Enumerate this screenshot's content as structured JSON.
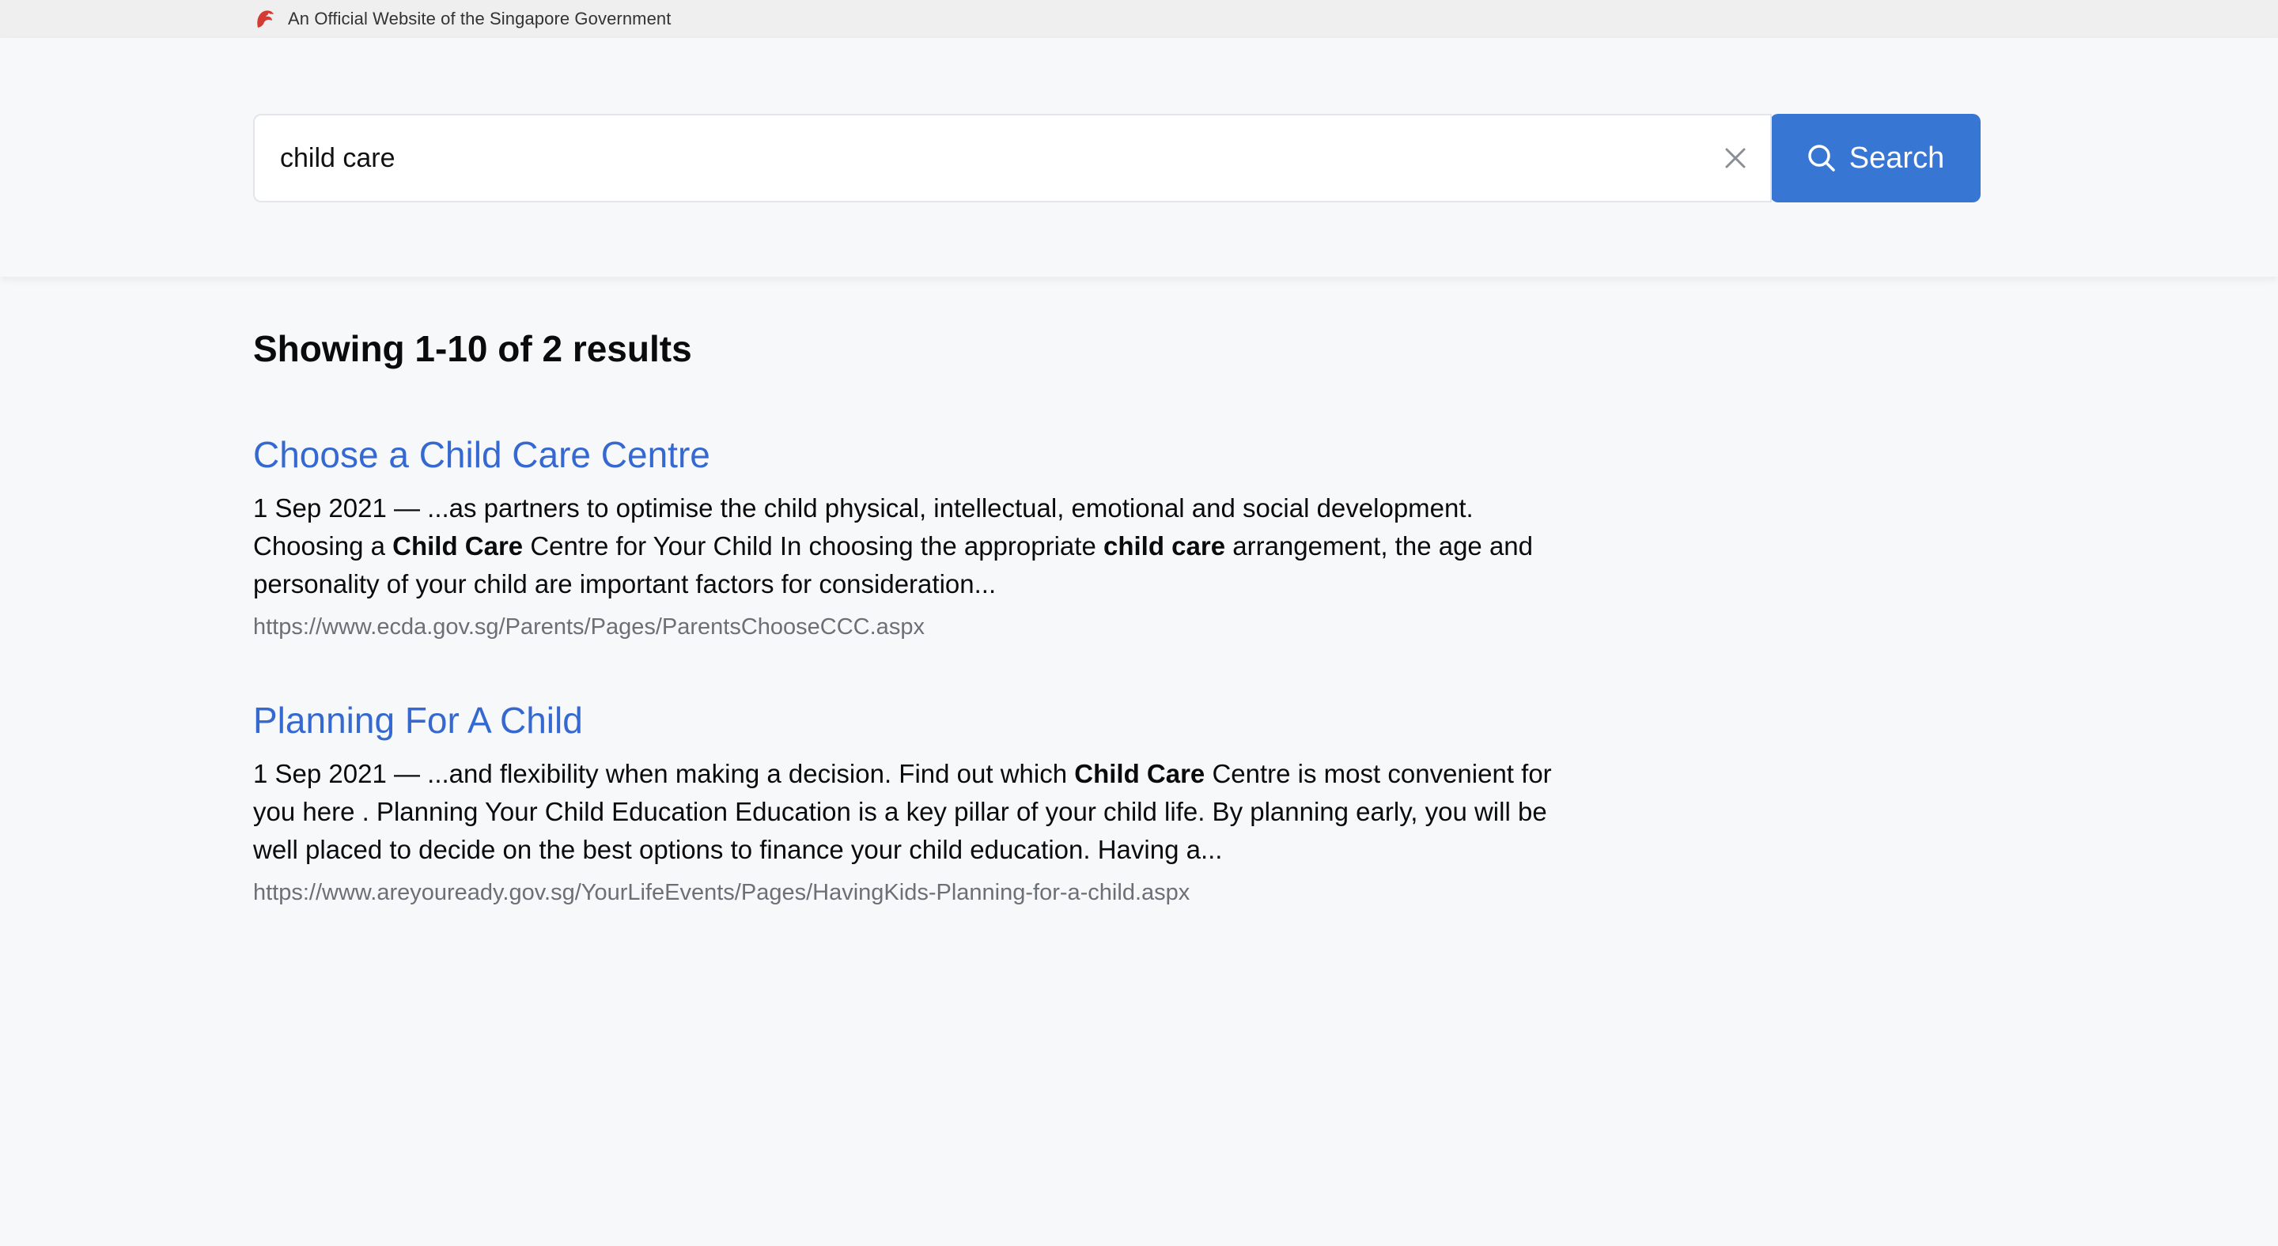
{
  "masthead": {
    "text": "An Official Website of the Singapore Government",
    "icon": "singapore-lion-head-icon",
    "icon_color": "#d43b35"
  },
  "search": {
    "value": "child care",
    "placeholder": "",
    "button_label": "Search",
    "button_color": "#3876d4"
  },
  "results": {
    "summary": "Showing 1-10 of 2 results",
    "items": [
      {
        "title": "Choose a Child Care Centre",
        "snippet_parts": [
          {
            "text": "1 Sep 2021 — ...as partners to optimise the child physical, intellectual, emotional and social development. Choosing a ",
            "bold": false
          },
          {
            "text": "Child Care",
            "bold": true
          },
          {
            "text": " Centre for Your Child In choosing the appropriate ",
            "bold": false
          },
          {
            "text": "child care",
            "bold": true
          },
          {
            "text": " arrangement, the age and personality of your child are important factors for consideration...",
            "bold": false
          }
        ],
        "url": "https://www.ecda.gov.sg/Parents/Pages/ParentsChooseCCC.aspx"
      },
      {
        "title": "Planning For A Child",
        "snippet_parts": [
          {
            "text": "1 Sep 2021 — ...and flexibility when making a decision. Find out which ",
            "bold": false
          },
          {
            "text": "Child Care",
            "bold": true
          },
          {
            "text": " Centre is most convenient for you here . Planning Your Child Education Education is a key pillar of your child life. By planning early, you will be well placed to decide on the best options to finance your child education. Having a...",
            "bold": false
          }
        ],
        "url": "https://www.areyouready.gov.sg/YourLifeEvents/Pages/HavingKids-Planning-for-a-child.aspx"
      }
    ]
  },
  "colors": {
    "link": "#3569d1",
    "url_gray": "#6b6f76",
    "background": "#f7f8fa"
  }
}
